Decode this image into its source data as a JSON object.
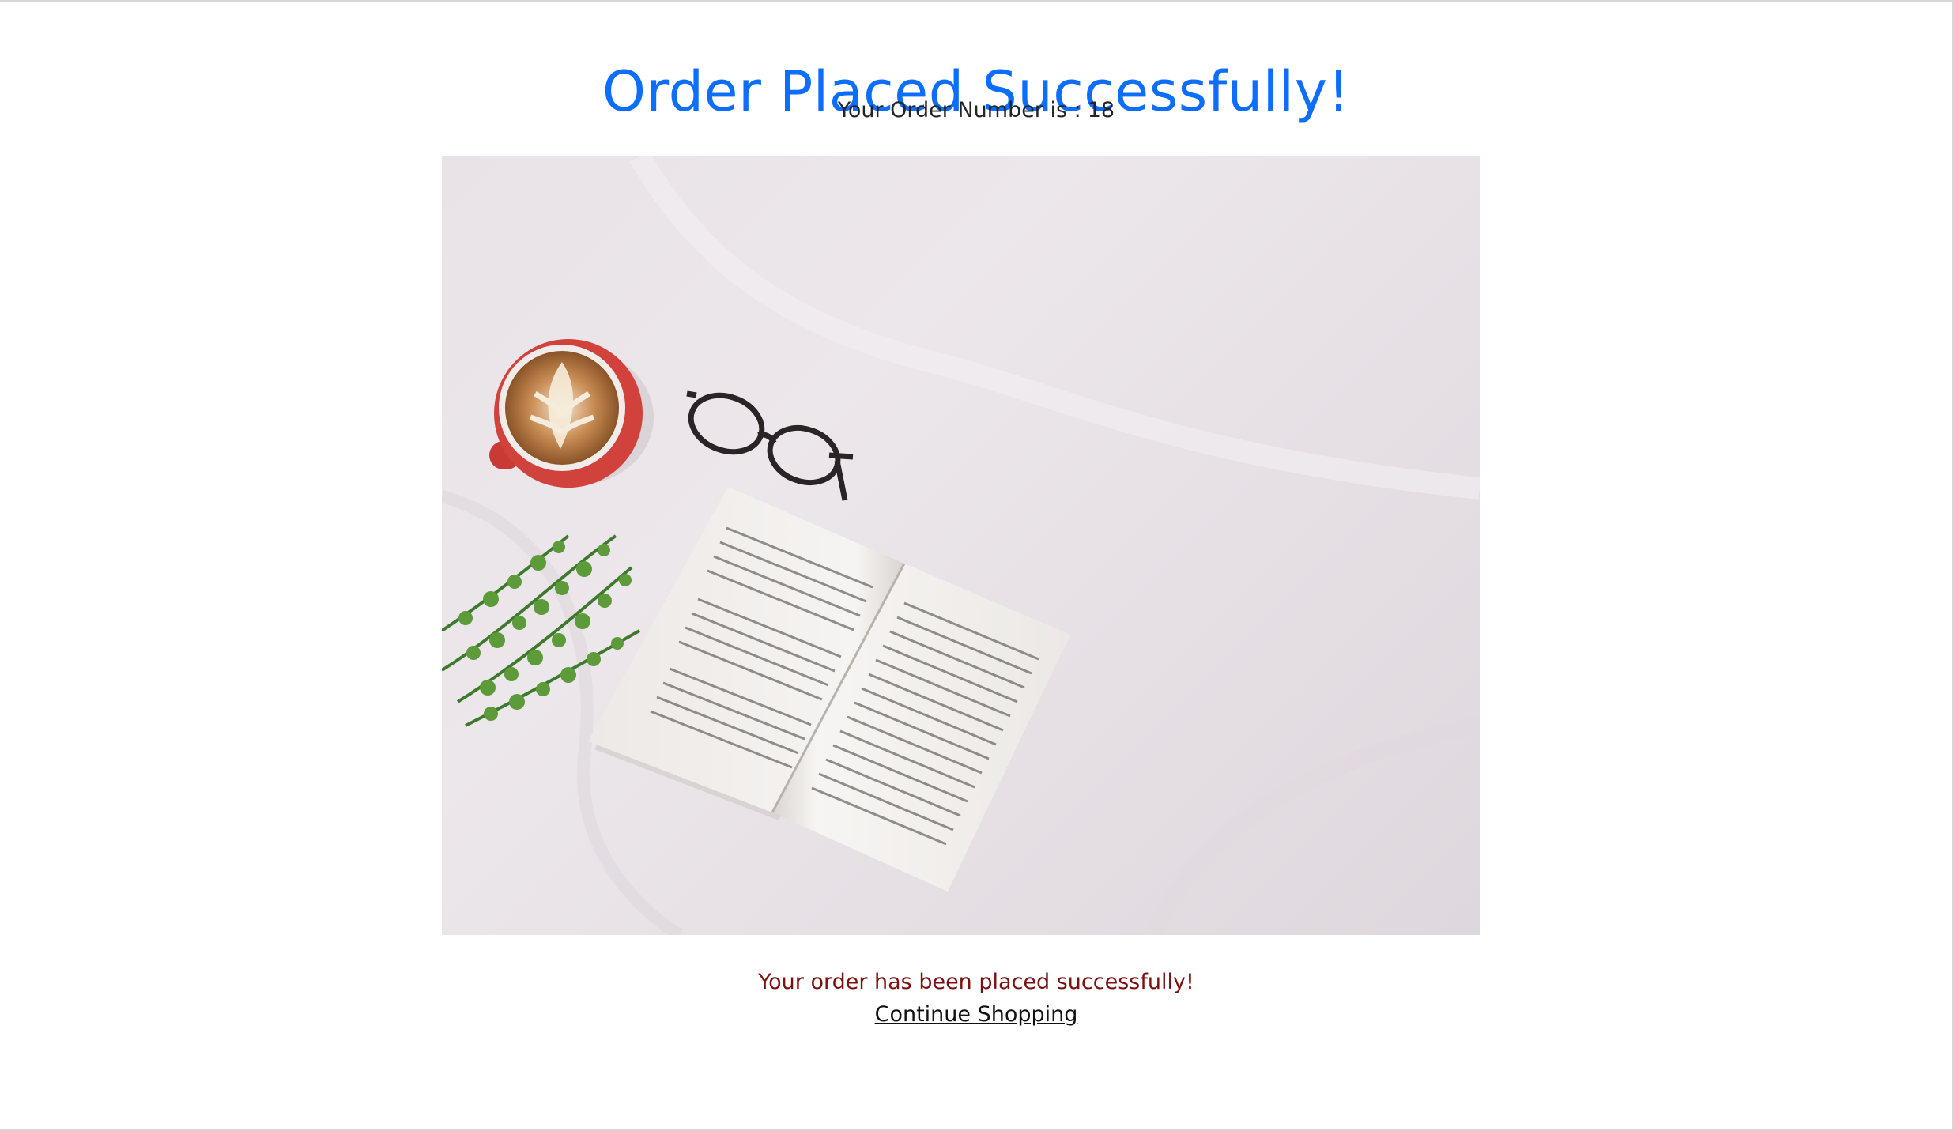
{
  "header": {
    "title": "Order Placed Successfully!",
    "order_number_label": "Your Order Number is :",
    "order_number": "18"
  },
  "hero_image": {
    "subject": "coffee-book-glasses-plant-flatlay"
  },
  "footer": {
    "success_message": "Your order has been placed successfully!",
    "continue_link": "Continue Shopping"
  },
  "colors": {
    "title": "#0d6efd",
    "success_message": "#7a1010",
    "text": "#212529"
  }
}
